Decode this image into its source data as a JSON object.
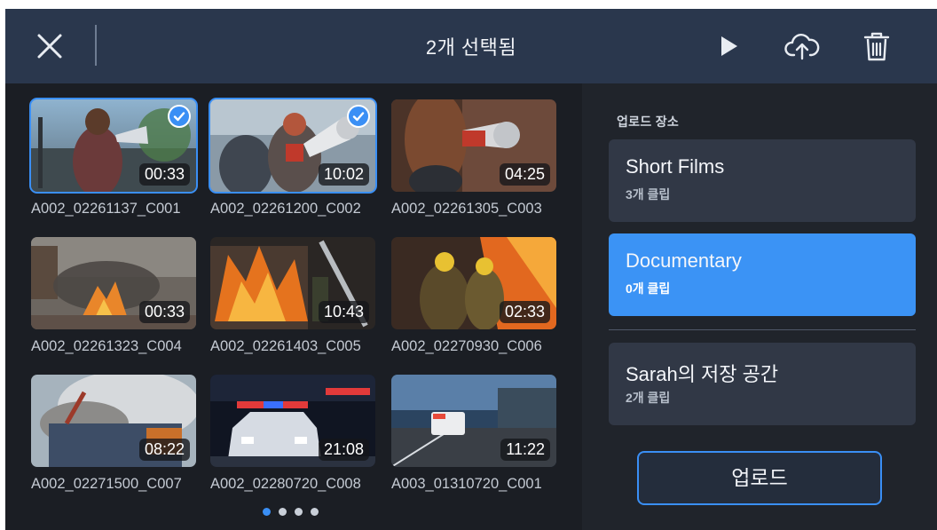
{
  "header": {
    "title": "2개 선택됨",
    "icons": [
      "close-icon",
      "play-icon",
      "cloud-upload-icon",
      "trash-icon"
    ]
  },
  "clips": [
    {
      "name": "A002_02261137_C001",
      "duration": "00:33",
      "selected": true
    },
    {
      "name": "A002_02261200_C002",
      "duration": "10:02",
      "selected": true
    },
    {
      "name": "A002_02261305_C003",
      "duration": "04:25",
      "selected": false
    },
    {
      "name": "A002_02261323_C004",
      "duration": "00:33",
      "selected": false
    },
    {
      "name": "A002_02261403_C005",
      "duration": "10:43",
      "selected": false
    },
    {
      "name": "A002_02270930_C006",
      "duration": "02:33",
      "selected": false
    },
    {
      "name": "A002_02271500_C007",
      "duration": "08:22",
      "selected": false
    },
    {
      "name": "A002_02280720_C008",
      "duration": "21:08",
      "selected": false
    },
    {
      "name": "A003_01310720_C001",
      "duration": "11:22",
      "selected": false
    }
  ],
  "pagination": {
    "pages": 4,
    "current": 1
  },
  "panel": {
    "heading": "업로드 장소",
    "destinations": [
      {
        "name": "Short Films",
        "count": "3개 클립",
        "active": false
      },
      {
        "name": "Documentary",
        "count": "0개 클립",
        "active": true
      },
      {
        "name": "Sarah의 저장 공간",
        "count": "2개 클립",
        "active": false
      }
    ],
    "upload_label": "업로드"
  },
  "colors": {
    "accent": "#3a8ff5",
    "header_bg": "#2a374d",
    "panel_bg": "#20242b",
    "card_bg": "#313846"
  }
}
